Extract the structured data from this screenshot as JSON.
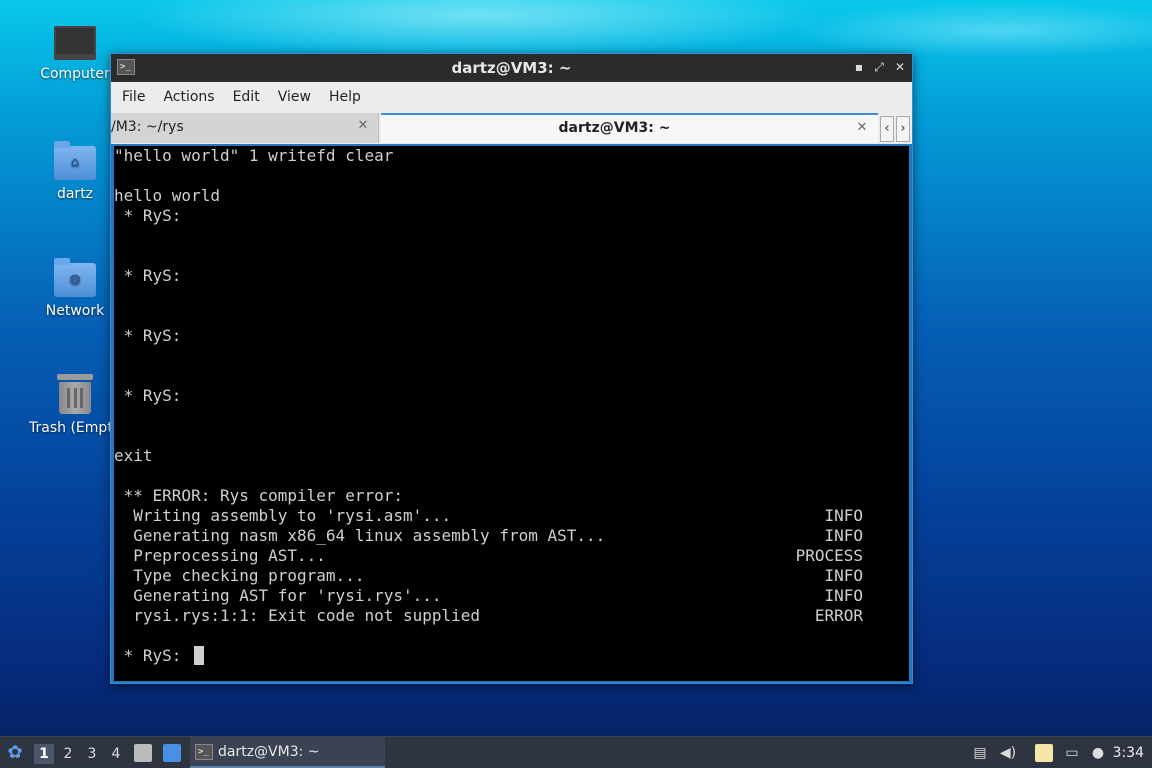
{
  "desktop": {
    "icons": [
      {
        "label": "Computer",
        "icon": "computer-icon"
      },
      {
        "label": "dartz",
        "icon": "home-folder-icon"
      },
      {
        "label": "Network",
        "icon": "network-folder-icon"
      },
      {
        "label": "Trash (Empt",
        "icon": "trash-icon"
      }
    ]
  },
  "window": {
    "title": "dartz@VM3: ~",
    "controls": {
      "minimize": "▪",
      "maximize": "⤢",
      "close": "✕"
    },
    "menu": [
      "File",
      "Actions",
      "Edit",
      "View",
      "Help"
    ],
    "tabs": [
      {
        "label": "/M3: ~/rys",
        "close": "✕"
      },
      {
        "label": "dartz@VM3: ~",
        "close": "✕"
      }
    ],
    "tab_scroll": {
      "left": "‹",
      "right": "›"
    }
  },
  "terminal": {
    "lines": [
      "\"hello world\" 1 writefd clear",
      "",
      "hello world",
      " * RyS:",
      "",
      "",
      " * RyS:",
      "",
      "",
      " * RyS:",
      "",
      "",
      " * RyS:",
      "",
      "",
      "exit",
      "",
      " ** ERROR: Rys compiler error:",
      "  Writing assembly to 'rysi.asm'...",
      "  Generating nasm x86_64 linux assembly from AST...",
      "  Preprocessing AST...",
      "  Type checking program...",
      "  Generating AST for 'rysi.rys'...",
      "  rysi.rys:1:1: Exit code not supplied",
      "",
      " * RyS: "
    ],
    "statuses": [
      {
        "line": 18,
        "text": "INFO"
      },
      {
        "line": 19,
        "text": "INFO"
      },
      {
        "line": 20,
        "text": "PROCESS"
      },
      {
        "line": 21,
        "text": "INFO"
      },
      {
        "line": 22,
        "text": "INFO"
      },
      {
        "line": 23,
        "text": "ERROR"
      }
    ]
  },
  "taskbar": {
    "workspaces": [
      "1",
      "2",
      "3",
      "4"
    ],
    "active_workspace": "1",
    "task": "dartz@VM3: ~",
    "tray": [
      "clipboard-icon",
      "volume-icon",
      "notes-icon",
      "network-icon",
      "notification-icon"
    ],
    "clock": "3:34"
  },
  "colors": {
    "terminal_bg": "#000000",
    "terminal_fg": "#d0d0d0",
    "window_border": "#1f78c0",
    "taskbar_bg": "#2e3440",
    "active_tab_accent": "#3a8fd6"
  }
}
